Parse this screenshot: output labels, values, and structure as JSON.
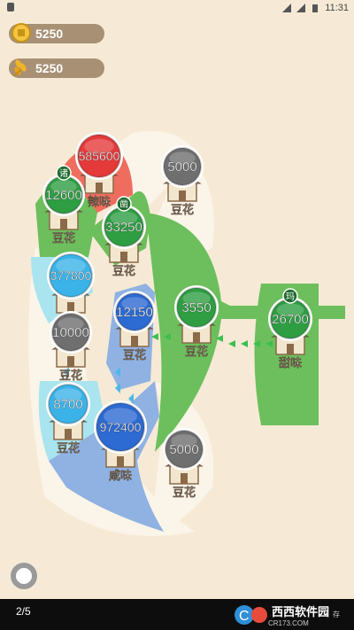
{
  "status_bar": {
    "time": "11:31"
  },
  "resources": {
    "coins": {
      "icon": "coin-icon",
      "value": "5250"
    },
    "grain": {
      "icon": "wheat-icon",
      "value": "5250"
    }
  },
  "colors": {
    "red": "#e43a3a",
    "green": "#2f9e43",
    "blue": "#2d6ad1",
    "cyan": "#3bb3e8",
    "gray": "#6f6f6f",
    "territory_green": "#6cbf5c",
    "territory_red": "#ef6d5f",
    "territory_cyan": "#a9e4ef",
    "territory_blue": "#8fb2e3",
    "road": "#fbf4e8"
  },
  "nodes": [
    {
      "id": "red-1",
      "value": "585600",
      "label": "辣味",
      "tag": "",
      "owner": "red"
    },
    {
      "id": "green-1",
      "value": "12600",
      "label": "豆花",
      "tag": "诸",
      "owner": "green"
    },
    {
      "id": "green-2",
      "value": "33250",
      "label": "豆花",
      "tag": "凿",
      "owner": "green"
    },
    {
      "id": "neutral-1",
      "value": "5000",
      "label": "豆花",
      "tag": "",
      "owner": "neutral"
    },
    {
      "id": "cyan-1",
      "value": "377800",
      "label": "",
      "tag": "",
      "owner": "cyan"
    },
    {
      "id": "blue-1",
      "value": "12150",
      "label": "豆花",
      "tag": "",
      "owner": "blue"
    },
    {
      "id": "green-3",
      "value": "3550",
      "label": "豆花",
      "tag": "",
      "owner": "green"
    },
    {
      "id": "green-4",
      "value": "26700",
      "label": "甜味",
      "tag": "玛",
      "owner": "green"
    },
    {
      "id": "neutral-2",
      "value": "10000",
      "label": "豆花",
      "tag": "",
      "owner": "neutral"
    },
    {
      "id": "cyan-2",
      "value": "8700",
      "label": "豆花",
      "tag": "",
      "owner": "cyan"
    },
    {
      "id": "blue-2",
      "value": "972400",
      "label": "咸味",
      "tag": "",
      "owner": "blue"
    },
    {
      "id": "neutral-3",
      "value": "5000",
      "label": "豆花",
      "tag": "",
      "owner": "neutral"
    }
  ],
  "footer": {
    "page_indicator": "2/5",
    "watermark_brand": "西西软件园",
    "watermark_url": "CR173.COM",
    "watermark_extra": "存"
  }
}
